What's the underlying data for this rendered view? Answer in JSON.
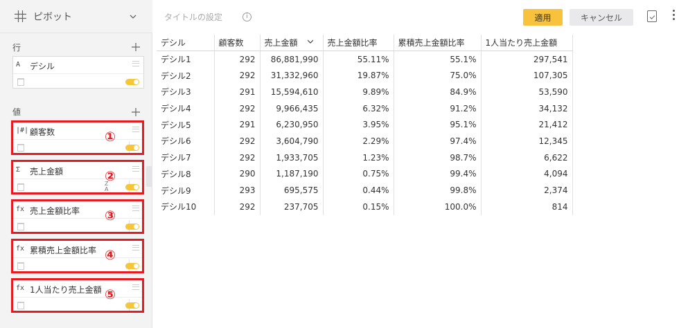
{
  "panel": {
    "title": "ピボット",
    "rows_label": "行",
    "values_label": "値",
    "row_field": {
      "type_icon": "A",
      "label": "デシル"
    },
    "value_fields": [
      {
        "type_icon": "|#|",
        "label": "顧客数",
        "marker": "①"
      },
      {
        "type_icon": "Σ",
        "label": "売上金額",
        "marker": "②"
      },
      {
        "type_icon": "fx",
        "label": "売上金額比率",
        "marker": "③"
      },
      {
        "type_icon": "fx",
        "label": "累積売上金額比率",
        "marker": "④"
      },
      {
        "type_icon": "fx",
        "label": "1人当たり売上金額",
        "marker": "⑤"
      }
    ],
    "sort_icon_top": "Z",
    "sort_icon_bottom": "A",
    "accent_color": "#f5c53a",
    "highlight_color": "#e8191f"
  },
  "toolbar": {
    "title_setting": "タイトルの設定",
    "info_glyph": "i",
    "apply_label": "適用",
    "cancel_label": "キャンセル",
    "apply_color": "#f9c23c"
  },
  "table": {
    "headers": [
      "デシル",
      "顧客数",
      "売上金額",
      "売上金額比率",
      "累積売上金額比率",
      "1人当たり売上金額"
    ],
    "rows": [
      [
        "デシル1",
        "292",
        "86,881,990",
        "55.11%",
        "55.1%",
        "297,541"
      ],
      [
        "デシル2",
        "292",
        "31,332,960",
        "19.87%",
        "75.0%",
        "107,305"
      ],
      [
        "デシル3",
        "291",
        "15,594,610",
        "9.89%",
        "84.9%",
        "53,590"
      ],
      [
        "デシル4",
        "292",
        "9,966,435",
        "6.32%",
        "91.2%",
        "34,132"
      ],
      [
        "デシル5",
        "291",
        "6,230,950",
        "3.95%",
        "95.1%",
        "21,412"
      ],
      [
        "デシル6",
        "292",
        "3,604,790",
        "2.29%",
        "97.4%",
        "12,345"
      ],
      [
        "デシル7",
        "292",
        "1,933,705",
        "1.23%",
        "98.7%",
        "6,622"
      ],
      [
        "デシル8",
        "290",
        "1,187,190",
        "0.75%",
        "99.4%",
        "4,094"
      ],
      [
        "デシル9",
        "293",
        "695,575",
        "0.44%",
        "99.8%",
        "2,374"
      ],
      [
        "デシル10",
        "292",
        "237,705",
        "0.15%",
        "100.0%",
        "814"
      ]
    ]
  }
}
